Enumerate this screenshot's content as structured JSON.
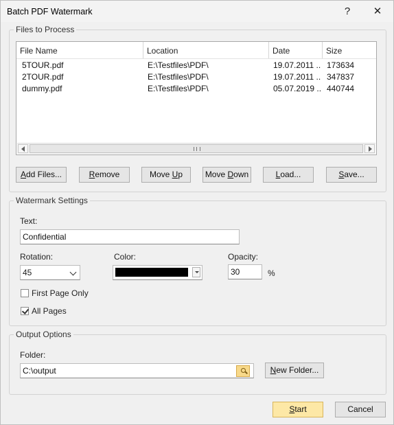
{
  "window": {
    "title": "Batch PDF Watermark",
    "help": "?",
    "close": "✕"
  },
  "files": {
    "legend": "Files to Process",
    "columns": [
      "File Name",
      "Location",
      "Date",
      "Size"
    ],
    "rows": [
      {
        "name": "5TOUR.pdf",
        "location": "E:\\Testfiles\\PDF\\",
        "date": "19.07.2011 ...",
        "size": "173634"
      },
      {
        "name": "2TOUR.pdf",
        "location": "E:\\Testfiles\\PDF\\",
        "date": "19.07.2011 ...",
        "size": "347837"
      },
      {
        "name": "dummy.pdf",
        "location": "E:\\Testfiles\\PDF\\",
        "date": "05.07.2019 ...",
        "size": "440744"
      }
    ],
    "buttons": {
      "add": {
        "pre": "",
        "u": "A",
        "post": "dd Files..."
      },
      "remove": {
        "pre": "",
        "u": "R",
        "post": "emove"
      },
      "move_up": {
        "pre": "Move ",
        "u": "U",
        "post": "p"
      },
      "move_down": {
        "pre": "Move ",
        "u": "D",
        "post": "own"
      },
      "load": {
        "pre": "",
        "u": "L",
        "post": "oad..."
      },
      "save": {
        "pre": "",
        "u": "S",
        "post": "ave..."
      }
    }
  },
  "watermark": {
    "legend": "Watermark Settings",
    "text_label": "Text:",
    "text_value": "Confidential",
    "rotation_label": "Rotation:",
    "rotation_value": "45",
    "color_label": "Color:",
    "color_value": "#000000",
    "opacity_label": "Opacity:",
    "opacity_value": "30",
    "opacity_unit": "%",
    "first_page_only": {
      "label": "First Page Only",
      "checked": false
    },
    "all_pages": {
      "label": "All Pages",
      "checked": true
    }
  },
  "output": {
    "legend": "Output Options",
    "folder_label": "Folder:",
    "folder_value": "C:\\output",
    "new_folder": {
      "pre": "",
      "u": "N",
      "post": "ew Folder..."
    }
  },
  "footer": {
    "start": {
      "pre": "",
      "u": "S",
      "post": "tart"
    },
    "cancel": "Cancel"
  }
}
